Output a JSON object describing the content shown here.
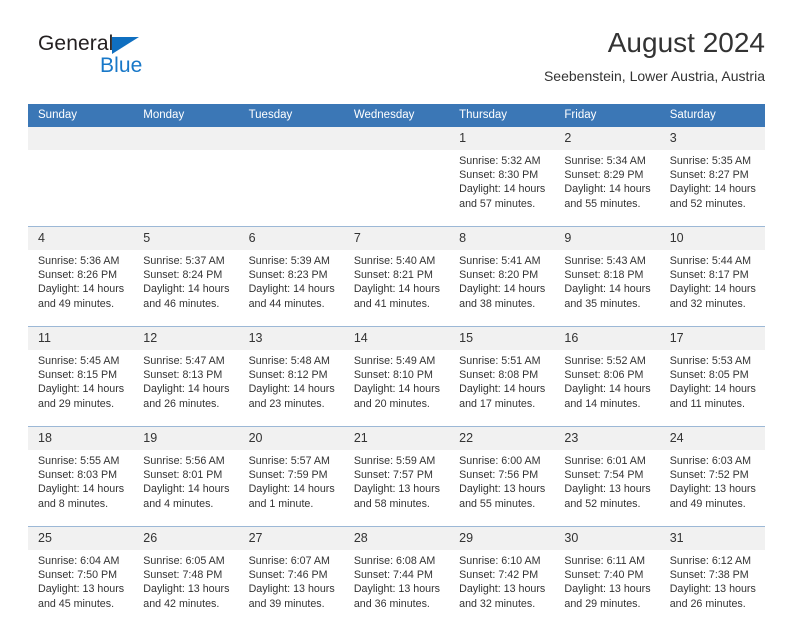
{
  "brand": {
    "name_part1": "General",
    "name_part2": "Blue",
    "triangle_icon": "triangle-icon",
    "primary_color": "#1878c8",
    "header_color": "#3b77b6"
  },
  "header": {
    "title": "August 2024",
    "location": "Seebenstein, Lower Austria, Austria"
  },
  "weekdays": [
    "Sunday",
    "Monday",
    "Tuesday",
    "Wednesday",
    "Thursday",
    "Friday",
    "Saturday"
  ],
  "weeks": [
    {
      "days": [
        {
          "num": "",
          "sunrise": "",
          "sunset": "",
          "daylight": ""
        },
        {
          "num": "",
          "sunrise": "",
          "sunset": "",
          "daylight": ""
        },
        {
          "num": "",
          "sunrise": "",
          "sunset": "",
          "daylight": ""
        },
        {
          "num": "",
          "sunrise": "",
          "sunset": "",
          "daylight": ""
        },
        {
          "num": "1",
          "sunrise": "Sunrise: 5:32 AM",
          "sunset": "Sunset: 8:30 PM",
          "daylight": "Daylight: 14 hours and 57 minutes."
        },
        {
          "num": "2",
          "sunrise": "Sunrise: 5:34 AM",
          "sunset": "Sunset: 8:29 PM",
          "daylight": "Daylight: 14 hours and 55 minutes."
        },
        {
          "num": "3",
          "sunrise": "Sunrise: 5:35 AM",
          "sunset": "Sunset: 8:27 PM",
          "daylight": "Daylight: 14 hours and 52 minutes."
        }
      ]
    },
    {
      "days": [
        {
          "num": "4",
          "sunrise": "Sunrise: 5:36 AM",
          "sunset": "Sunset: 8:26 PM",
          "daylight": "Daylight: 14 hours and 49 minutes."
        },
        {
          "num": "5",
          "sunrise": "Sunrise: 5:37 AM",
          "sunset": "Sunset: 8:24 PM",
          "daylight": "Daylight: 14 hours and 46 minutes."
        },
        {
          "num": "6",
          "sunrise": "Sunrise: 5:39 AM",
          "sunset": "Sunset: 8:23 PM",
          "daylight": "Daylight: 14 hours and 44 minutes."
        },
        {
          "num": "7",
          "sunrise": "Sunrise: 5:40 AM",
          "sunset": "Sunset: 8:21 PM",
          "daylight": "Daylight: 14 hours and 41 minutes."
        },
        {
          "num": "8",
          "sunrise": "Sunrise: 5:41 AM",
          "sunset": "Sunset: 8:20 PM",
          "daylight": "Daylight: 14 hours and 38 minutes."
        },
        {
          "num": "9",
          "sunrise": "Sunrise: 5:43 AM",
          "sunset": "Sunset: 8:18 PM",
          "daylight": "Daylight: 14 hours and 35 minutes."
        },
        {
          "num": "10",
          "sunrise": "Sunrise: 5:44 AM",
          "sunset": "Sunset: 8:17 PM",
          "daylight": "Daylight: 14 hours and 32 minutes."
        }
      ]
    },
    {
      "days": [
        {
          "num": "11",
          "sunrise": "Sunrise: 5:45 AM",
          "sunset": "Sunset: 8:15 PM",
          "daylight": "Daylight: 14 hours and 29 minutes."
        },
        {
          "num": "12",
          "sunrise": "Sunrise: 5:47 AM",
          "sunset": "Sunset: 8:13 PM",
          "daylight": "Daylight: 14 hours and 26 minutes."
        },
        {
          "num": "13",
          "sunrise": "Sunrise: 5:48 AM",
          "sunset": "Sunset: 8:12 PM",
          "daylight": "Daylight: 14 hours and 23 minutes."
        },
        {
          "num": "14",
          "sunrise": "Sunrise: 5:49 AM",
          "sunset": "Sunset: 8:10 PM",
          "daylight": "Daylight: 14 hours and 20 minutes."
        },
        {
          "num": "15",
          "sunrise": "Sunrise: 5:51 AM",
          "sunset": "Sunset: 8:08 PM",
          "daylight": "Daylight: 14 hours and 17 minutes."
        },
        {
          "num": "16",
          "sunrise": "Sunrise: 5:52 AM",
          "sunset": "Sunset: 8:06 PM",
          "daylight": "Daylight: 14 hours and 14 minutes."
        },
        {
          "num": "17",
          "sunrise": "Sunrise: 5:53 AM",
          "sunset": "Sunset: 8:05 PM",
          "daylight": "Daylight: 14 hours and 11 minutes."
        }
      ]
    },
    {
      "days": [
        {
          "num": "18",
          "sunrise": "Sunrise: 5:55 AM",
          "sunset": "Sunset: 8:03 PM",
          "daylight": "Daylight: 14 hours and 8 minutes."
        },
        {
          "num": "19",
          "sunrise": "Sunrise: 5:56 AM",
          "sunset": "Sunset: 8:01 PM",
          "daylight": "Daylight: 14 hours and 4 minutes."
        },
        {
          "num": "20",
          "sunrise": "Sunrise: 5:57 AM",
          "sunset": "Sunset: 7:59 PM",
          "daylight": "Daylight: 14 hours and 1 minute."
        },
        {
          "num": "21",
          "sunrise": "Sunrise: 5:59 AM",
          "sunset": "Sunset: 7:57 PM",
          "daylight": "Daylight: 13 hours and 58 minutes."
        },
        {
          "num": "22",
          "sunrise": "Sunrise: 6:00 AM",
          "sunset": "Sunset: 7:56 PM",
          "daylight": "Daylight: 13 hours and 55 minutes."
        },
        {
          "num": "23",
          "sunrise": "Sunrise: 6:01 AM",
          "sunset": "Sunset: 7:54 PM",
          "daylight": "Daylight: 13 hours and 52 minutes."
        },
        {
          "num": "24",
          "sunrise": "Sunrise: 6:03 AM",
          "sunset": "Sunset: 7:52 PM",
          "daylight": "Daylight: 13 hours and 49 minutes."
        }
      ]
    },
    {
      "days": [
        {
          "num": "25",
          "sunrise": "Sunrise: 6:04 AM",
          "sunset": "Sunset: 7:50 PM",
          "daylight": "Daylight: 13 hours and 45 minutes."
        },
        {
          "num": "26",
          "sunrise": "Sunrise: 6:05 AM",
          "sunset": "Sunset: 7:48 PM",
          "daylight": "Daylight: 13 hours and 42 minutes."
        },
        {
          "num": "27",
          "sunrise": "Sunrise: 6:07 AM",
          "sunset": "Sunset: 7:46 PM",
          "daylight": "Daylight: 13 hours and 39 minutes."
        },
        {
          "num": "28",
          "sunrise": "Sunrise: 6:08 AM",
          "sunset": "Sunset: 7:44 PM",
          "daylight": "Daylight: 13 hours and 36 minutes."
        },
        {
          "num": "29",
          "sunrise": "Sunrise: 6:10 AM",
          "sunset": "Sunset: 7:42 PM",
          "daylight": "Daylight: 13 hours and 32 minutes."
        },
        {
          "num": "30",
          "sunrise": "Sunrise: 6:11 AM",
          "sunset": "Sunset: 7:40 PM",
          "daylight": "Daylight: 13 hours and 29 minutes."
        },
        {
          "num": "31",
          "sunrise": "Sunrise: 6:12 AM",
          "sunset": "Sunset: 7:38 PM",
          "daylight": "Daylight: 13 hours and 26 minutes."
        }
      ]
    }
  ]
}
